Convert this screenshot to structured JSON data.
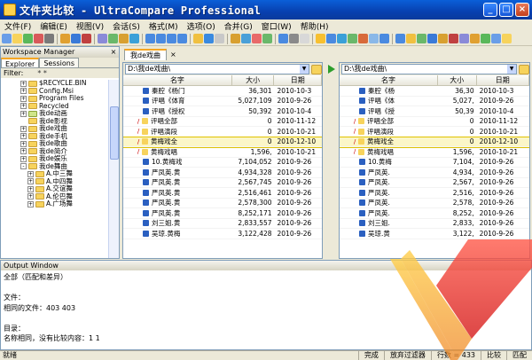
{
  "window": {
    "title": "文件夹比较 - UltraCompare Professional"
  },
  "menu": [
    "文件(F)",
    "编辑(E)",
    "视图(V)",
    "会话(S)",
    "格式(M)",
    "选项(O)",
    "合并(G)",
    "窗口(W)",
    "帮助(H)"
  ],
  "workspace": {
    "title": "Workspace Manager",
    "tabs": [
      "Explorer",
      "Sessions"
    ],
    "filter_label": "Filter:",
    "filter_value": "* *",
    "tree": [
      {
        "label": "$RECYCLE.BIN",
        "exp": "+",
        "c": "yellow",
        "i": 1
      },
      {
        "label": "Config.Msi",
        "exp": "+",
        "c": "yellow",
        "i": 1
      },
      {
        "label": "Program Files",
        "exp": "+",
        "c": "yellow",
        "i": 1
      },
      {
        "label": "Recycled",
        "exp": "+",
        "c": "yellow",
        "i": 1
      },
      {
        "label": "我de动画",
        "exp": "+",
        "c": "green",
        "i": 1
      },
      {
        "label": "我de影视",
        "exp": "",
        "c": "yellow",
        "i": 1
      },
      {
        "label": "我de戏曲",
        "exp": "+",
        "c": "yellow",
        "i": 1
      },
      {
        "label": "我de手机",
        "exp": "+",
        "c": "yellow",
        "i": 1
      },
      {
        "label": "我de歌曲",
        "exp": "+",
        "c": "yellow",
        "i": 1
      },
      {
        "label": "我de简介",
        "exp": "+",
        "c": "yellow",
        "i": 1
      },
      {
        "label": "我de娱乐",
        "exp": "+",
        "c": "yellow",
        "i": 1
      },
      {
        "label": "我de舞曲",
        "exp": "-",
        "c": "yellow",
        "i": 1
      },
      {
        "label": "A.中三舞",
        "exp": "+",
        "c": "yellow",
        "i": 2
      },
      {
        "label": "A.中四舞",
        "exp": "+",
        "c": "yellow",
        "i": 2
      },
      {
        "label": "A.交谊舞",
        "exp": "+",
        "c": "yellow",
        "i": 2
      },
      {
        "label": "A.伦巴舞",
        "exp": "+",
        "c": "yellow",
        "i": 2
      },
      {
        "label": "A.广场舞",
        "exp": "+",
        "c": "yellow",
        "i": 2
      }
    ]
  },
  "doc_tab": "我de戏曲",
  "left": {
    "path": "D:\\我de戏曲\\",
    "columns": [
      "名字",
      "大小",
      "日期"
    ],
    "rows": [
      {
        "name": "秦腔《杨门",
        "size": "36,301",
        "date": "2010-10-3",
        "ic": "doc",
        "m": ""
      },
      {
        "name": "评唱《体育",
        "size": "5,027,109",
        "date": "2010-9-26",
        "ic": "doc",
        "m": ""
      },
      {
        "name": "评唱《授权",
        "size": "50,392",
        "date": "2010-10-4",
        "ic": "doc",
        "m": ""
      },
      {
        "name": "评唱全部",
        "size": "0",
        "date": "2010-11-12",
        "ic": "fold",
        "m": "/"
      },
      {
        "name": "评唱演段",
        "size": "0",
        "date": "2010-10-21",
        "ic": "fold",
        "m": "/"
      },
      {
        "name": "黄梅戏全",
        "size": "0",
        "date": "2010-12-10",
        "ic": "fold",
        "m": "/",
        "sel": true
      },
      {
        "name": "黄梅戏唱",
        "size": "1,596,",
        "date": "2010-10-21",
        "ic": "fold",
        "m": "/"
      },
      {
        "name": "10.黄梅戏",
        "size": "7,104,052",
        "date": "2010-9-26",
        "ic": "doc",
        "m": ""
      },
      {
        "name": "严凤英.黄",
        "size": "4,934,328",
        "date": "2010-9-26",
        "ic": "doc",
        "m": ""
      },
      {
        "name": "严凤英.黄",
        "size": "2,567,745",
        "date": "2010-9-26",
        "ic": "doc",
        "m": ""
      },
      {
        "name": "严凤英.黄",
        "size": "2,516,461",
        "date": "2010-9-26",
        "ic": "doc",
        "m": ""
      },
      {
        "name": "严凤英.黄",
        "size": "2,578,300",
        "date": "2010-9-26",
        "ic": "doc",
        "m": ""
      },
      {
        "name": "严凤英.黄",
        "size": "8,252,171",
        "date": "2010-9-26",
        "ic": "doc",
        "m": ""
      },
      {
        "name": "刘三姐.黄",
        "size": "2,833,557",
        "date": "2010-9-26",
        "ic": "doc",
        "m": ""
      },
      {
        "name": "吴琼.黄梅",
        "size": "3,122,428",
        "date": "2010-9-26",
        "ic": "doc",
        "m": ""
      }
    ]
  },
  "right": {
    "path": "D:\\我de戏曲\\",
    "columns": [
      "名字",
      "大小",
      "日期"
    ],
    "rows": [
      {
        "name": "秦腔《杨",
        "size": "36,30",
        "date": "2010-10-3",
        "ic": "doc",
        "m": ""
      },
      {
        "name": "评唱《体",
        "size": "5,027,",
        "date": "2010-9-26",
        "ic": "doc",
        "m": ""
      },
      {
        "name": "评唱《授",
        "size": "50,39",
        "date": "2010-10-4",
        "ic": "doc",
        "m": ""
      },
      {
        "name": "评唱全部",
        "size": "0",
        "date": "2010-11-12",
        "ic": "fold",
        "m": "/"
      },
      {
        "name": "评唱演段",
        "size": "0",
        "date": "2010-10-21",
        "ic": "fold",
        "m": "/"
      },
      {
        "name": "黄梅戏全",
        "size": "0",
        "date": "2010-12-10",
        "ic": "fold",
        "m": "/",
        "sel": true
      },
      {
        "name": "黄梅戏唱",
        "size": "1,596,",
        "date": "2010-10-21",
        "ic": "fold",
        "m": "/"
      },
      {
        "name": "10.黄梅",
        "size": "7,104,",
        "date": "2010-9-26",
        "ic": "doc",
        "m": ""
      },
      {
        "name": "严凤英.",
        "size": "4,934,",
        "date": "2010-9-26",
        "ic": "doc",
        "m": ""
      },
      {
        "name": "严凤英.",
        "size": "2,567,",
        "date": "2010-9-26",
        "ic": "doc",
        "m": ""
      },
      {
        "name": "严凤英.",
        "size": "2,516,",
        "date": "2010-9-26",
        "ic": "doc",
        "m": ""
      },
      {
        "name": "严凤英.",
        "size": "2,578,",
        "date": "2010-9-26",
        "ic": "doc",
        "m": ""
      },
      {
        "name": "严凤英.",
        "size": "8,252,",
        "date": "2010-9-26",
        "ic": "doc",
        "m": ""
      },
      {
        "name": "刘三姐.",
        "size": "2,833,",
        "date": "2010-9-26",
        "ic": "doc",
        "m": ""
      },
      {
        "name": "吴琼.黄",
        "size": "3,122,",
        "date": "2010-9-26",
        "ic": "doc",
        "m": ""
      }
    ]
  },
  "output": {
    "title": "Output Window",
    "lines": [
      "全部（匹配和差异）",
      "",
      "文件：",
      "相同的文件：403  403",
      "",
      "目录：",
      "名称相同，没有比较内容：1  1"
    ]
  },
  "status": {
    "left": "就绪",
    "parts": [
      "完成",
      "放弃过滤器",
      "行数 = 433",
      "比较",
      "匹配"
    ]
  }
}
